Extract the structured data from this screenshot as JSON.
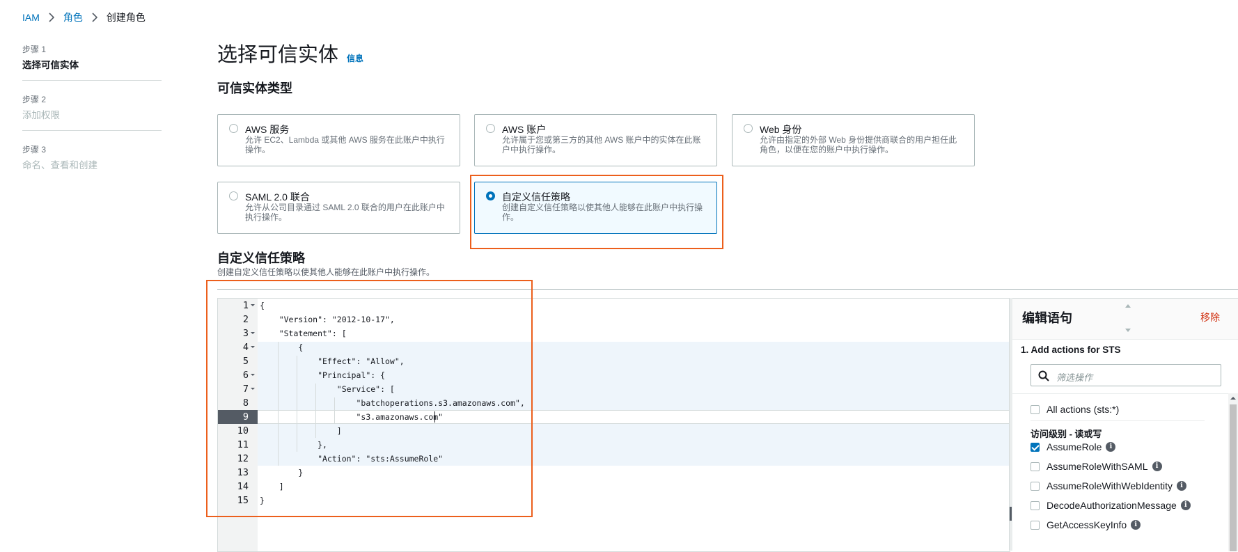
{
  "breadcrumb": [
    {
      "label": "IAM",
      "link": true
    },
    {
      "label": "角色",
      "link": true
    },
    {
      "label": "创建角色",
      "link": false
    }
  ],
  "steps": [
    {
      "num": "步骤 1",
      "label": "选择可信实体",
      "state": "active"
    },
    {
      "num": "步骤 2",
      "label": "添加权限",
      "state": "disabled"
    },
    {
      "num": "步骤 3",
      "label": "命名、查看和创建",
      "state": "disabled"
    }
  ],
  "page": {
    "title": "选择可信实体",
    "info": "信息",
    "section_title": "可信实体类型"
  },
  "tiles": [
    {
      "title": "AWS 服务",
      "desc": "允许 EC2、Lambda 或其他 AWS 服务在此账户中执行操作。",
      "selected": false
    },
    {
      "title": "AWS 账户",
      "desc": "允许属于您或第三方的其他 AWS 账户中的实体在此账户中执行操作。",
      "selected": false
    },
    {
      "title": "Web 身份",
      "desc": "允许由指定的外部 Web 身份提供商联合的用户担任此角色，以便在您的账户中执行操作。",
      "selected": false
    },
    {
      "title": "SAML 2.0 联合",
      "desc": "允许从公司目录通过 SAML 2.0 联合的用户在此账户中执行操作。",
      "selected": false
    },
    {
      "title": "自定义信任策略",
      "desc": "创建自定义信任策略以使其他人能够在此账户中执行操作。",
      "selected": true
    }
  ],
  "custom_policy": {
    "title": "自定义信任策略",
    "desc": "创建自定义信任策略以使其他人能够在此账户中执行操作。"
  },
  "editor": {
    "lines": [
      "{",
      "    \"Version\": \"2012-10-17\",",
      "    \"Statement\": [",
      "        {",
      "            \"Effect\": \"Allow\",",
      "            \"Principal\": {",
      "                \"Service\": [",
      "                    \"batchoperations.s3.amazonaws.com\",",
      "                    \"s3.amazonaws.com\"",
      "                ]",
      "            },",
      "            \"Action\": \"sts:AssumeRole\"",
      "        }",
      "    ]",
      "}"
    ],
    "line_numbers": [
      "1",
      "2",
      "3",
      "4",
      "5",
      "6",
      "7",
      "8",
      "9",
      "10",
      "11",
      "12",
      "13",
      "14",
      "15"
    ],
    "current_line": 9
  },
  "statement_panel": {
    "title": "编辑语句",
    "remove": "移除",
    "step_heading": "1. Add actions for STS",
    "search_placeholder": "筛选操作",
    "all_actions": "All actions (sts:*)",
    "group_label": "访问级别 - 读或写",
    "actions": [
      {
        "label": "AssumeRole",
        "checked": true
      },
      {
        "label": "AssumeRoleWithSAML",
        "checked": false
      },
      {
        "label": "AssumeRoleWithWebIdentity",
        "checked": false
      },
      {
        "label": "DecodeAuthorizationMessage",
        "checked": false
      },
      {
        "label": "GetAccessKeyInfo",
        "checked": false
      }
    ]
  },
  "colors": {
    "accent": "#0073bb",
    "highlight": "#ec5f1c",
    "remove": "#d13212"
  },
  "icons": {
    "breadcrumb_separator": "chevron-right-icon",
    "search": "search-icon",
    "info": "info-icon",
    "fold": "fold-arrow-icon"
  }
}
